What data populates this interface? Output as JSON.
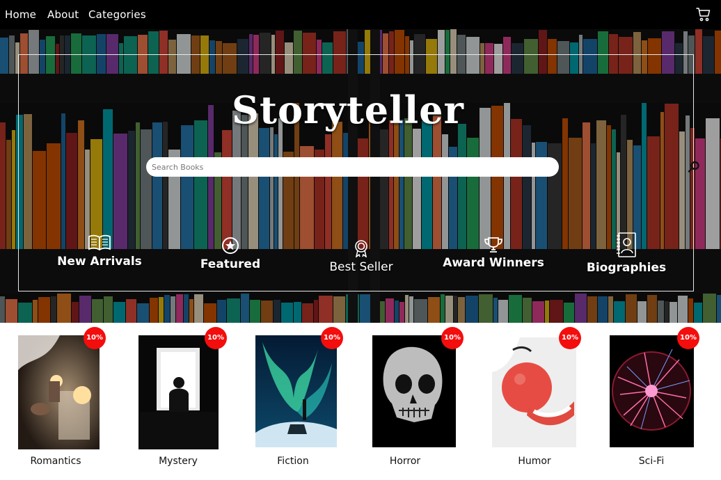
{
  "nav": {
    "items": [
      "Home",
      "About",
      "Categories"
    ],
    "cart_icon": "shopping-cart-icon"
  },
  "hero": {
    "title": "Storyteller",
    "search": {
      "placeholder": "Search Books",
      "value": "",
      "icon": "search-icon"
    },
    "links": [
      {
        "label": "New Arrivals",
        "icon": "open-book-icon"
      },
      {
        "label": "Featured",
        "icon": "star-badge-icon"
      },
      {
        "label": "Best Seller",
        "icon": "award-ribbon-icon"
      },
      {
        "label": "Award Winners",
        "icon": "trophy-icon"
      },
      {
        "label": "Biographies",
        "icon": "contact-card-icon"
      }
    ]
  },
  "categories": [
    {
      "name": "Romantics",
      "badge": "10%"
    },
    {
      "name": "Mystery",
      "badge": "10%"
    },
    {
      "name": "Fiction",
      "badge": "10%"
    },
    {
      "name": "Horror",
      "badge": "10%"
    },
    {
      "name": "Humor",
      "badge": "10%"
    },
    {
      "name": "Sci-Fi",
      "badge": "10%"
    }
  ],
  "colors": {
    "nav_bg": "#000000",
    "badge": "#f40d0d",
    "text": "#111111"
  }
}
